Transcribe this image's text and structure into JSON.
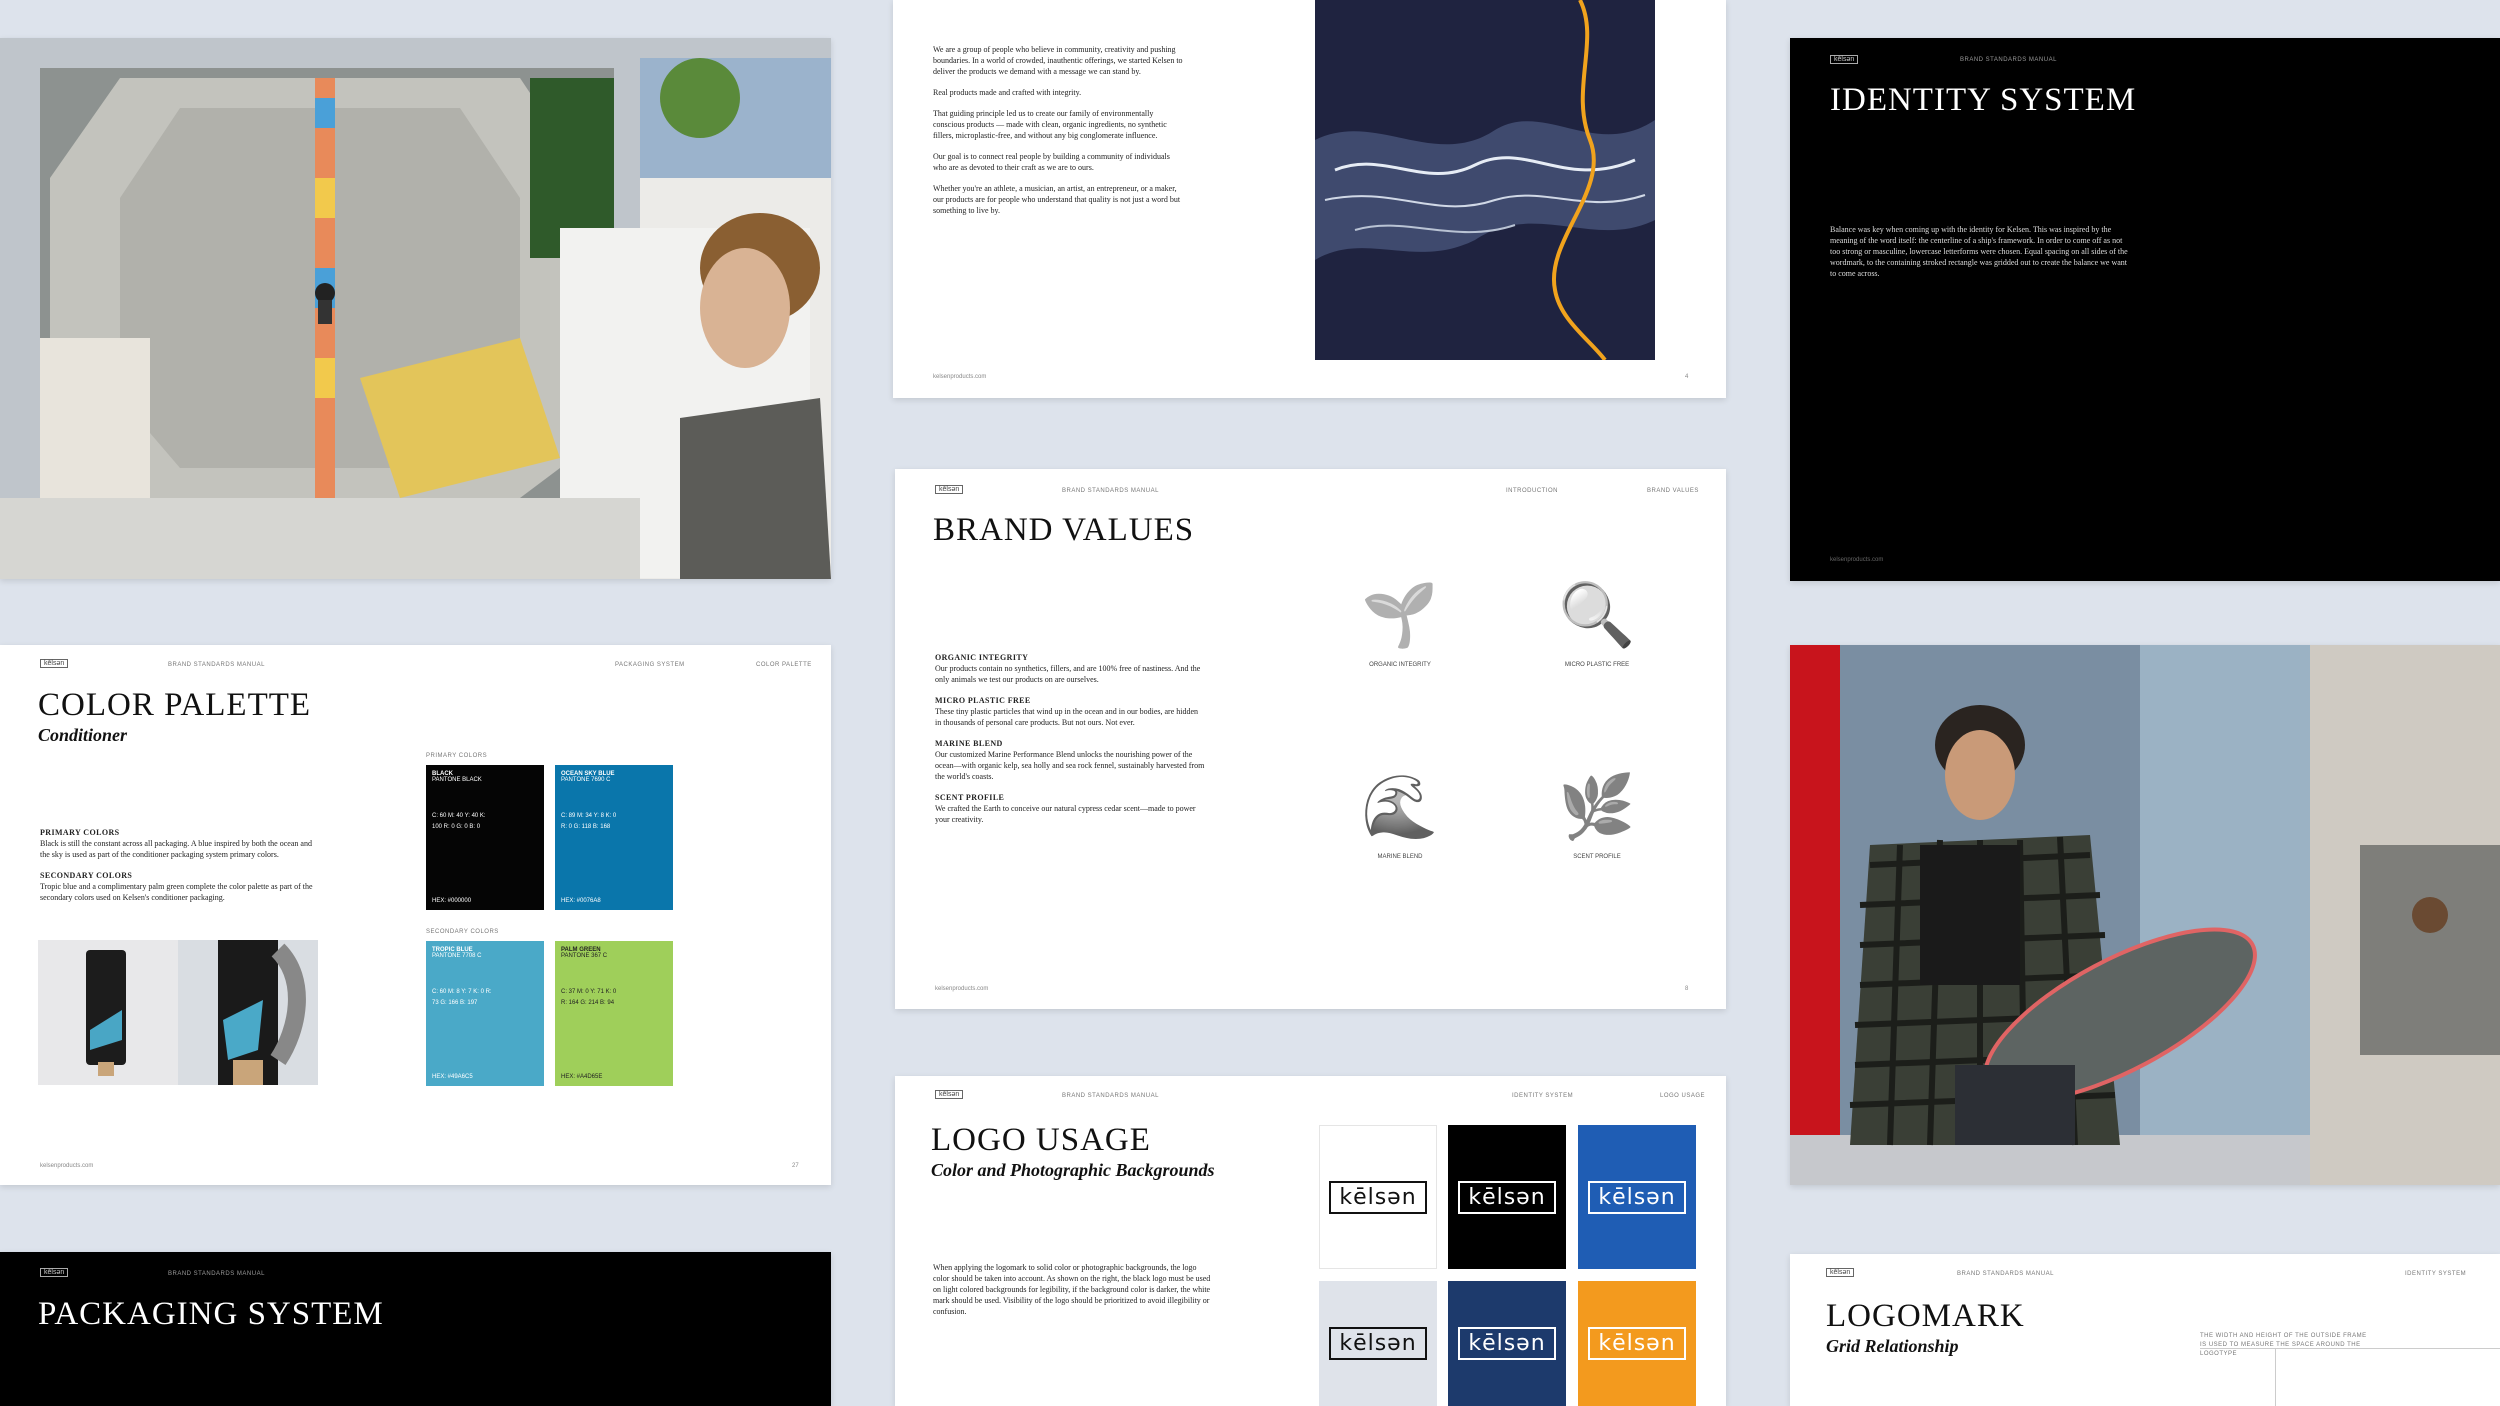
{
  "spreads": {
    "skate_photo": {
      "alt": "skateboarder on concrete ramp and portrait"
    },
    "manifesto": {
      "paragraphs": [
        "We are a group of people who believe in community, creativity and pushing boundaries. In a world of crowded, inauthentic offerings, we started Kelsen to deliver the products we demand with a message we can stand by.",
        "Real products made and crafted with integrity.",
        "That guiding principle led us to create our family of environmentally conscious products — made with clean, organic ingredients, no synthetic fillers, microplastic-free, and without any big conglomerate influence.",
        "Our goal is to connect real people by building a community of individuals who are as devoted to their craft as we are to ours.",
        "Whether you're an athlete, a musician, an artist, an entrepreneur, or a maker, our products are for people who understand that quality is not just a word but something to live by."
      ],
      "footer": "kelsenproducts.com",
      "page": "4"
    },
    "identity": {
      "logo": "kēlsən",
      "header": "BRAND STANDARDS MANUAL",
      "title": "IDENTITY SYSTEM",
      "body": "Balance was key when coming up with the identity for Kelsen. This was inspired by the meaning of the word itself: the centerline of a ship's framework. In order to come off as not too strong or masculine, lowercase letterforms were chosen. Equal spacing on all sides of the wordmark, to the containing stroked rectangle was gridded out to create the balance we want to come across.",
      "footer": "kelsenproducts.com"
    },
    "color_palette": {
      "logo": "kēlsən",
      "header": [
        "BRAND STANDARDS MANUAL",
        "PACKAGING SYSTEM",
        "COLOR PALETTE"
      ],
      "title": "COLOR PALETTE",
      "subtitle": "Conditioner",
      "primary_heading": "PRIMARY COLORS",
      "primary_text": "Black is still the constant across all packaging. A blue inspired by both the ocean and the sky is used as part of the conditioner packaging system primary colors.",
      "secondary_heading": "SECONDARY COLORS",
      "secondary_text": "Tropic blue and a complimentary palm green complete the color palette as part of the secondary colors used on Kelsen's conditioner packaging.",
      "primary_label": "PRIMARY COLORS",
      "secondary_label": "SECONDARY COLORS",
      "swatches": [
        {
          "name": "BLACK",
          "pantone": "PANTONE BLACK",
          "vals": "C: 60  M: 40  Y: 40  K: 100  R: 0  G: 0  B: 0",
          "hex": "HEX: #000000",
          "color": "#050505"
        },
        {
          "name": "OCEAN SKY BLUE",
          "pantone": "PANTONE 7690 C",
          "vals": "C: 89  M: 34  Y: 8  K: 0  R: 0  G: 118  B: 168",
          "hex": "HEX: #0076A8",
          "color": "#0a76ab"
        },
        {
          "name": "TROPIC BLUE",
          "pantone": "PANTONE 7708 C",
          "vals": "C: 60  M: 8  Y: 7  K: 0  R: 73  G: 166  B: 197",
          "hex": "HEX: #49A6C5",
          "color": "#4aa9c8"
        },
        {
          "name": "PALM GREEN",
          "pantone": "PANTONE 367 C",
          "vals": "C: 37  M: 0  Y: 71  K: 0  R: 164  G: 214  B: 94",
          "hex": "HEX: #A4D65E",
          "color": "#9fcf5a"
        }
      ],
      "footer": "kelsenproducts.com",
      "page": "27"
    },
    "brand_values": {
      "logo": "kēlsən",
      "header": [
        "BRAND STANDARDS MANUAL",
        "INTRODUCTION",
        "BRAND VALUES"
      ],
      "title": "BRAND VALUES",
      "items": [
        {
          "heading": "ORGANIC INTEGRITY",
          "text": "Our products contain no synthetics, fillers, and are 100% free of nastiness. And the only animals we test our products on are ourselves."
        },
        {
          "heading": "MICRO PLASTIC FREE",
          "text": "These tiny plastic particles that wind up in the ocean and in our bodies, are hidden in thousands of personal care products. But not ours. Not ever."
        },
        {
          "heading": "MARINE BLEND",
          "text": "Our customized Marine Performance Blend unlocks the nourishing power of the ocean—with organic kelp, sea holly and sea rock fennel, sustainably harvested from the world's coasts."
        },
        {
          "heading": "SCENT PROFILE",
          "text": "We crafted the Earth to conceive our natural cypress cedar scent—made to power your creativity."
        }
      ],
      "icons": [
        {
          "label": "ORGANIC INTEGRITY",
          "glyph": "🌱"
        },
        {
          "label": "MICRO PLASTIC FREE",
          "glyph": "🔍"
        },
        {
          "label": "MARINE BLEND",
          "glyph": "🌊"
        },
        {
          "label": "SCENT PROFILE",
          "glyph": "🌿"
        }
      ],
      "footer": "kelsenproducts.com",
      "page": "8"
    },
    "skater_portrait": {
      "alt": "man in plaid shirt holding skateboard"
    },
    "packaging": {
      "logo": "kēlsən",
      "header": "BRAND STANDARDS MANUAL",
      "title": "PACKAGING SYSTEM"
    },
    "logo_usage": {
      "logo": "kēlsən",
      "header": [
        "BRAND STANDARDS MANUAL",
        "IDENTITY SYSTEM",
        "LOGO USAGE"
      ],
      "title": "LOGO USAGE",
      "subtitle": "Color and Photographic Backgrounds",
      "body": "When applying the logomark to solid color or photographic backgrounds, the logo color should be taken into account. As shown on the right, the black logo must be used on light colored backgrounds for legibility, if the background color is darker, the white mark should be used. Visibility of the logo should be prioritized to avoid illegibility or confusion.",
      "tiles": [
        {
          "wordmark": "kēlsən",
          "bg": "#ffffff",
          "fg": "#111111"
        },
        {
          "wordmark": "kēlsən",
          "bg": "#000000",
          "fg": "#ffffff"
        },
        {
          "wordmark": "kēlsən",
          "bg": "#1f5db4",
          "fg": "#ffffff"
        },
        {
          "wordmark": "kēlsən",
          "bg": "#dfe3ea",
          "fg": "#111111"
        },
        {
          "wordmark": "kēlsən",
          "bg": "#1d3a6c",
          "fg": "#ffffff"
        },
        {
          "wordmark": "kēlsən",
          "bg": "#f39a1e",
          "fg": "#ffffff"
        }
      ]
    },
    "logomark": {
      "logo": "kēlsən",
      "header": [
        "BRAND STANDARDS MANUAL",
        "IDENTITY SYSTEM"
      ],
      "title": "LOGOMARK",
      "subtitle": "Grid Relationship",
      "note": "THE WIDTH AND HEIGHT OF THE OUTSIDE FRAME IS USED TO MEASURE THE SPACE AROUND THE LOGOTYPE"
    }
  }
}
